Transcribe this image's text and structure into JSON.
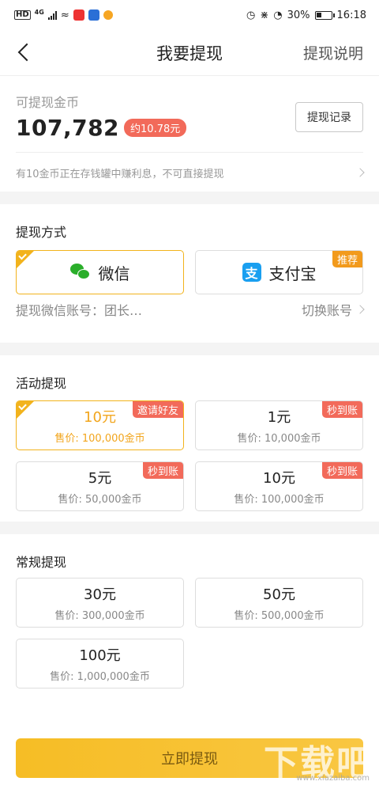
{
  "status_bar": {
    "left": [
      "HD",
      "4G"
    ],
    "battery": "30%",
    "time": "16:18"
  },
  "nav": {
    "title": "我要提现",
    "right_link": "提现说明"
  },
  "balance": {
    "label": "可提现金币",
    "amount": "107,782",
    "approx": "约10.78元",
    "record_button": "提现记录",
    "notice": "有10金币正在存钱罐中赚利息，不可直接提现"
  },
  "methods": {
    "title": "提现方式",
    "options": [
      {
        "label": "微信",
        "icon": "wechat-icon",
        "selected": true
      },
      {
        "label": "支付宝",
        "icon": "alipay-icon",
        "selected": false,
        "tag": "推荐"
      }
    ],
    "account_label": "提现微信账号：团长…",
    "switch_label": "切换账号"
  },
  "activity": {
    "title": "活动提现",
    "items": [
      {
        "amount": "10元",
        "price": "售价: 100,000金币",
        "tag": "邀请好友",
        "selected": true
      },
      {
        "amount": "1元",
        "price": "售价: 10,000金币",
        "tag": "秒到账",
        "selected": false
      },
      {
        "amount": "5元",
        "price": "售价: 50,000金币",
        "tag": "秒到账",
        "selected": false
      },
      {
        "amount": "10元",
        "price": "售价: 100,000金币",
        "tag": "秒到账",
        "selected": false
      }
    ]
  },
  "regular": {
    "title": "常规提现",
    "items": [
      {
        "amount": "30元",
        "price": "售价: 300,000金币"
      },
      {
        "amount": "50元",
        "price": "售价: 500,000金币"
      },
      {
        "amount": "100元",
        "price": "售价: 1,000,000金币"
      }
    ]
  },
  "submit_button": "立即提现",
  "watermark": {
    "text": "下载吧",
    "url": "www.xiazaiba.com"
  },
  "colors": {
    "accent": "#f2b31c",
    "tag_red": "#f26a5a",
    "tag_orange": "#f29a1c",
    "wechat": "#2aae2a",
    "alipay": "#1a9ff0"
  }
}
